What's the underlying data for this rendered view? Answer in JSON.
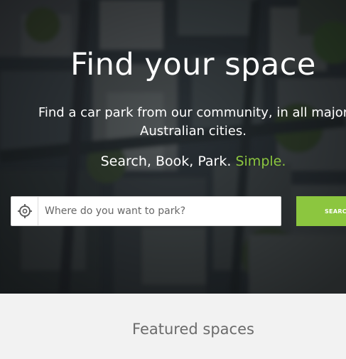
{
  "hero": {
    "title": "Find your space",
    "subtitle_line1": "Find a car park from our community, in all major",
    "subtitle_line2": "Australian cities.",
    "tagline": "Search, Book, Park.",
    "tagline_accent": "Simple."
  },
  "search": {
    "placeholder": "Where do you want to park?",
    "value": "",
    "button_label": "SEARCH",
    "locate_icon": "crosshair-icon"
  },
  "featured": {
    "title": "Featured spaces"
  },
  "colors": {
    "accent": "#8cc63f",
    "hero_overlay": "#2b3238",
    "section_bg": "#f2f2f2"
  }
}
